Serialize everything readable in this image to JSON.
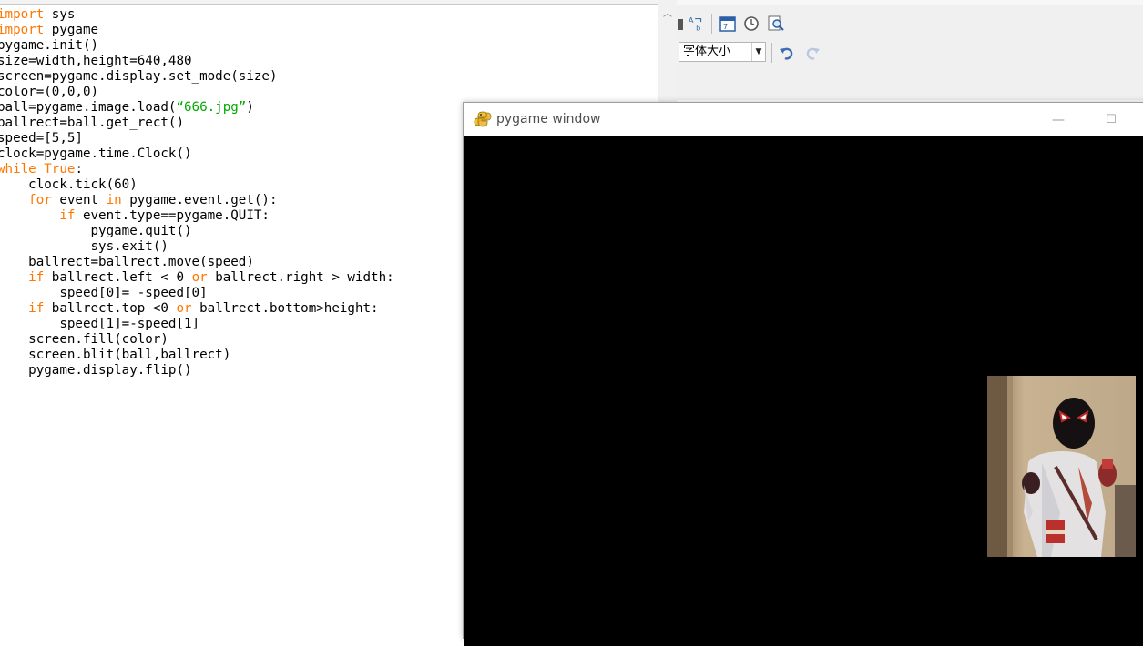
{
  "editor": {
    "code_lines": [
      [
        {
          "t": "import",
          "c": "kw"
        },
        {
          "t": " sys",
          "c": ""
        }
      ],
      [
        {
          "t": "import",
          "c": "kw"
        },
        {
          "t": " pygame",
          "c": ""
        }
      ],
      [
        {
          "t": "pygame.init()",
          "c": ""
        }
      ],
      [
        {
          "t": "size=width,height=640,480",
          "c": ""
        }
      ],
      [
        {
          "t": "screen=pygame.display.set_mode(size)",
          "c": ""
        }
      ],
      [
        {
          "t": "color=(0,0,0)",
          "c": ""
        }
      ],
      [
        {
          "t": "ball=pygame.image.load(",
          "c": ""
        },
        {
          "t": "“666.jpg”",
          "c": "str"
        },
        {
          "t": ")",
          "c": ""
        }
      ],
      [
        {
          "t": "ballrect=ball.get_rect()",
          "c": ""
        }
      ],
      [
        {
          "t": "speed=[5,5]",
          "c": ""
        }
      ],
      [
        {
          "t": "clock=pygame.time.Clock()",
          "c": ""
        }
      ],
      [
        {
          "t": "while",
          "c": "kw"
        },
        {
          "t": " ",
          "c": ""
        },
        {
          "t": "True",
          "c": "kw"
        },
        {
          "t": ":",
          "c": ""
        }
      ],
      [
        {
          "t": "    clock.tick(60)",
          "c": ""
        }
      ],
      [
        {
          "t": "    ",
          "c": ""
        },
        {
          "t": "for",
          "c": "kw"
        },
        {
          "t": " event ",
          "c": ""
        },
        {
          "t": "in",
          "c": "kw"
        },
        {
          "t": " pygame.event.get():",
          "c": ""
        }
      ],
      [
        {
          "t": "        ",
          "c": ""
        },
        {
          "t": "if",
          "c": "kw"
        },
        {
          "t": " event.type==pygame.QUIT:",
          "c": ""
        }
      ],
      [
        {
          "t": "            pygame.quit()",
          "c": ""
        }
      ],
      [
        {
          "t": "            sys.exit()",
          "c": ""
        }
      ],
      [
        {
          "t": "    ballrect=ballrect.move(speed)",
          "c": ""
        }
      ],
      [
        {
          "t": "    ",
          "c": ""
        },
        {
          "t": "if",
          "c": "kw"
        },
        {
          "t": " ballrect.left < 0 ",
          "c": ""
        },
        {
          "t": "or",
          "c": "kw"
        },
        {
          "t": " ballrect.right > width:",
          "c": ""
        }
      ],
      [
        {
          "t": "        speed[0]= -speed[0]",
          "c": ""
        }
      ],
      [
        {
          "t": "    ",
          "c": ""
        },
        {
          "t": "if",
          "c": "kw"
        },
        {
          "t": " ballrect.top <0 ",
          "c": ""
        },
        {
          "t": "or",
          "c": "kw"
        },
        {
          "t": " ballrect.bottom>height:",
          "c": ""
        }
      ],
      [
        {
          "t": "        speed[1]=-speed[1]",
          "c": ""
        }
      ],
      [
        {
          "t": "    screen.fill(color)",
          "c": ""
        }
      ],
      [
        {
          "t": "    screen.blit(ball,ballrect)",
          "c": ""
        }
      ],
      [
        {
          "t": "    pygame.display.flip()",
          "c": ""
        }
      ]
    ]
  },
  "background_app": {
    "font_size_select": "字体大小",
    "toolbar_icons": [
      "binoculars-icon",
      "replace-icon",
      "calendar-icon",
      "clock-icon",
      "preview-icon",
      "undo-icon",
      "redo-icon"
    ]
  },
  "pygame_window": {
    "title": "pygame window",
    "icon": "python-snake-icon",
    "minimize_glyph": "—",
    "maximize_glyph": "☐",
    "canvas_color": "#000000"
  },
  "colors": {
    "keyword": "#ff7700",
    "string": "#00aa00",
    "undo": "#3b6db0"
  }
}
